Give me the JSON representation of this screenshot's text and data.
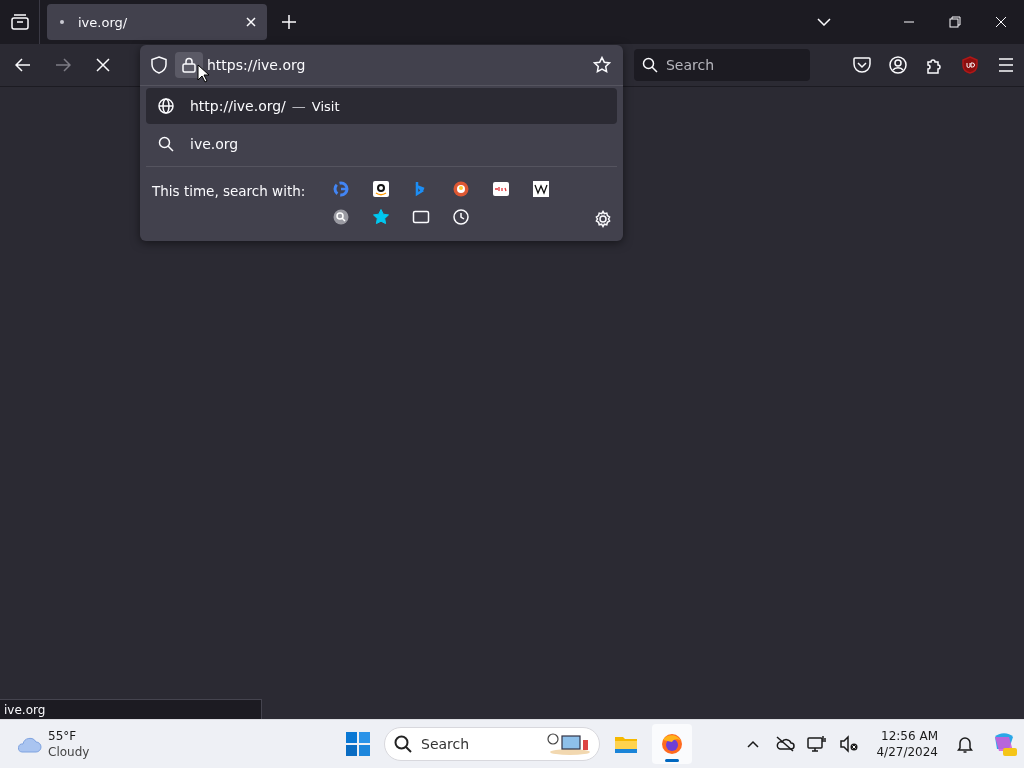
{
  "tabs": [
    {
      "title": "ive.org/",
      "selected": true
    }
  ],
  "navigation": {
    "loading": true
  },
  "urlbar": {
    "value": "https://ive.org"
  },
  "suggestions": [
    {
      "kind": "visit",
      "url": "http://ive.org/",
      "separator": "—",
      "action": "Visit",
      "selected": true
    },
    {
      "kind": "search",
      "text": "ive.org",
      "selected": false
    }
  ],
  "one_offs": {
    "label": "This time, search with:",
    "engines": [
      {
        "kind": "google"
      },
      {
        "kind": "amazon"
      },
      {
        "kind": "bing"
      },
      {
        "kind": "duckduckgo"
      },
      {
        "kind": "ebay"
      },
      {
        "kind": "wikipedia"
      },
      {
        "kind": "search-history"
      },
      {
        "kind": "bookmarks"
      },
      {
        "kind": "tabs"
      },
      {
        "kind": "history"
      }
    ]
  },
  "search": {
    "placeholder": "Search"
  },
  "status_bar": {
    "text": "ive.org"
  },
  "taskbar": {
    "weather": {
      "temperature": "55°F",
      "condition": "Cloudy"
    },
    "search": {
      "placeholder": "Search"
    },
    "apps": [
      {
        "kind": "explorer",
        "active": false
      },
      {
        "kind": "firefox",
        "active": true
      }
    ],
    "time": "12:56 AM",
    "date": "4/27/2024"
  }
}
